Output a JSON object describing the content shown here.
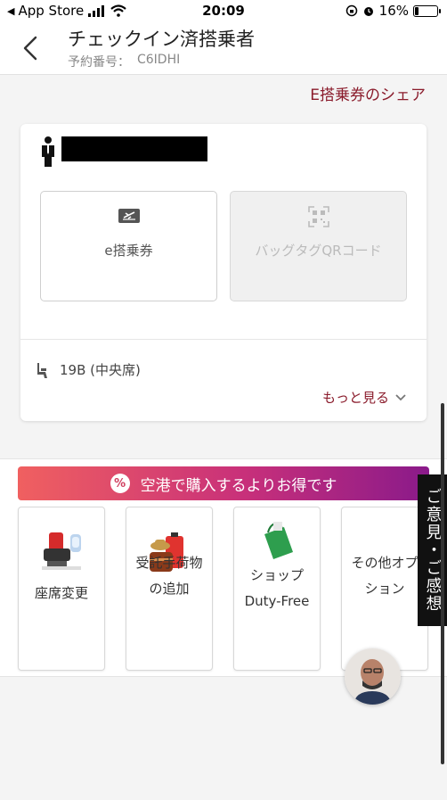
{
  "status_bar": {
    "back_app": "App Store",
    "time": "20:09",
    "battery": "16%",
    "battery_level": 0.16
  },
  "header": {
    "title": "チェックイン済搭乗者",
    "booking_label": "予約番号：",
    "booking_code": "C6IDHI"
  },
  "share_link": "E搭乗券のシェア",
  "passenger_card": {
    "tiles": [
      {
        "label": "e搭乗券",
        "icon": "boarding-pass-icon",
        "enabled": true
      },
      {
        "label": "バッグタグQRコード",
        "icon": "qr-code-icon",
        "enabled": false
      }
    ],
    "seat": "19B (中央席)",
    "more": "もっと見る"
  },
  "promo": {
    "banner": "空港で購入するよりお得です",
    "badge": "%",
    "services": [
      {
        "label": "座席変更",
        "icon": "seat-icon"
      },
      {
        "label": "受託手荷物の追加",
        "icon": "luggage-icon"
      },
      {
        "label": "ショップDuty-Free",
        "icon": "shopping-bag-icon"
      },
      {
        "label": "その他オプション",
        "icon": "options-icon"
      }
    ]
  },
  "feedback": "ご意見・ご感想",
  "colors": {
    "accent": "#8a1b2b",
    "banner_start": "#f06060",
    "banner_end": "#8a1a8a"
  }
}
